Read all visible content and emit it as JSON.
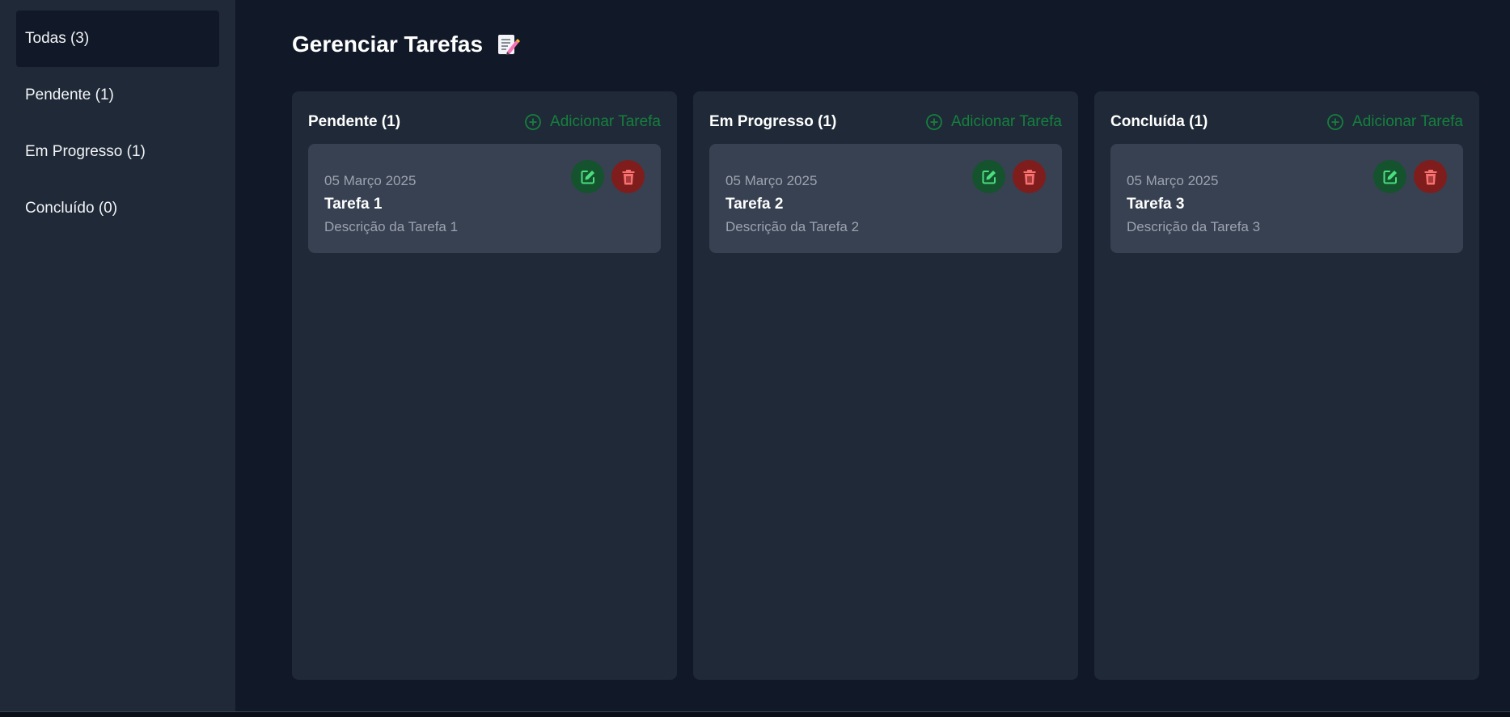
{
  "sidebar": {
    "items": [
      {
        "label": "Todas (3)",
        "active": true
      },
      {
        "label": "Pendente (1)",
        "active": false
      },
      {
        "label": "Em Progresso (1)",
        "active": false
      },
      {
        "label": "Concluído (0)",
        "active": false
      }
    ]
  },
  "header": {
    "title": "Gerenciar Tarefas",
    "title_icon": "memo-icon"
  },
  "columns": [
    {
      "title": "Pendente (1)",
      "add_label": "Adicionar Tarefa",
      "tasks": [
        {
          "date": "05 Março 2025",
          "title": "Tarefa 1",
          "description": "Descrição da Tarefa 1"
        }
      ]
    },
    {
      "title": "Em Progresso (1)",
      "add_label": "Adicionar Tarefa",
      "tasks": [
        {
          "date": "05 Março 2025",
          "title": "Tarefa 2",
          "description": "Descrição da Tarefa 2"
        }
      ]
    },
    {
      "title": "Concluída (1)",
      "add_label": "Adicionar Tarefa",
      "tasks": [
        {
          "date": "05 Março 2025",
          "title": "Tarefa 3",
          "description": "Descrição da Tarefa 3"
        }
      ]
    }
  ],
  "icons": {
    "add": "plus-circle-icon",
    "edit": "edit-icon",
    "delete": "trash-icon"
  },
  "colors": {
    "background": "#111827",
    "panel": "#1f2937",
    "card": "#374151",
    "add_accent": "#15803d",
    "edit_button": "#14532d",
    "edit_icon": "#4ade80",
    "delete_button": "#7f1d1d",
    "delete_icon": "#f87171"
  }
}
